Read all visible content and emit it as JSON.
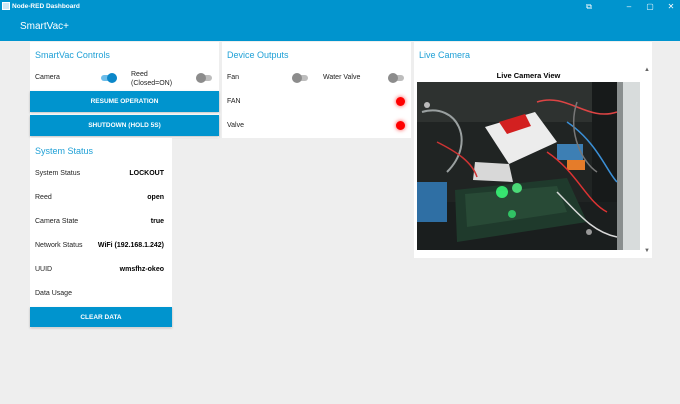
{
  "window": {
    "title": "Node-RED Dashboard",
    "controls": {
      "restore": "⧉",
      "minimize": "–",
      "maximize": "▢",
      "close": "✕"
    }
  },
  "header": {
    "title": "SmartVac+"
  },
  "controls_card": {
    "title": "SmartVac Controls",
    "camera_label": "Camera",
    "camera_on": true,
    "reed_label_1": "Reed",
    "reed_label_2": "(Closed=ON)",
    "reed_on": false,
    "resume_button": "RESUME OPERATION",
    "shutdown_button": "SHUTDOWN (HOLD 5S)"
  },
  "status_card": {
    "title": "System Status",
    "rows": [
      {
        "label": "System Status",
        "value": "LOCKOUT"
      },
      {
        "label": "Reed",
        "value": "open"
      },
      {
        "label": "Camera State",
        "value": "true"
      },
      {
        "label": "Network Status",
        "value": "WiFi (192.168.1.242)"
      },
      {
        "label": "UUID",
        "value": "wmsfhz-okeo"
      },
      {
        "label": "Data Usage",
        "value": ""
      }
    ],
    "clear_button": "CLEAR DATA"
  },
  "outputs_card": {
    "title": "Device Outputs",
    "fan_label": "Fan",
    "fan_on": false,
    "water_valve_label": "Water Valve",
    "water_valve_on": false,
    "fan_led_label": "FAN",
    "valve_led_label": "Valve",
    "led_color": "#ff0000"
  },
  "camera_card": {
    "title": "Live Camera",
    "caption": "Live Camera View"
  },
  "colors": {
    "accent": "#0094ce",
    "title_text": "#1fa0d6",
    "background": "#eeeeee"
  }
}
